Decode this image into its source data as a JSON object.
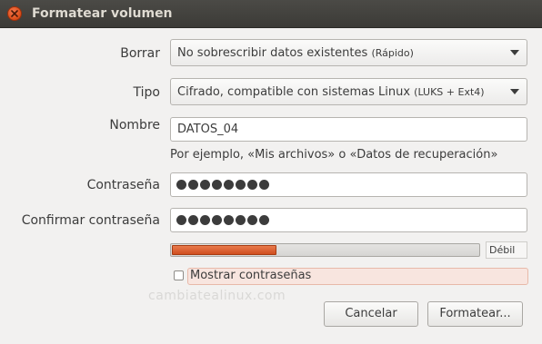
{
  "window": {
    "title": "Formatear volumen"
  },
  "form": {
    "erase": {
      "label": "Borrar",
      "value_main": "No sobrescribir datos existentes",
      "value_note": "(Rápido)"
    },
    "type": {
      "label": "Tipo",
      "value_main": "Cifrado, compatible con sistemas Linux",
      "value_note": "(LUKS + Ext4)"
    },
    "name": {
      "label": "Nombre",
      "value": "DATOS_04",
      "hint": "Por ejemplo, «Mis archivos» o «Datos de recuperación»"
    },
    "password": {
      "label": "Contraseña",
      "masked_length": 8
    },
    "confirm_password": {
      "label": "Confirmar contraseña",
      "masked_length": 8
    },
    "strength": {
      "level": 0.34,
      "label": "Débil",
      "color": "#e0592a"
    },
    "show_passwords": {
      "label": "Mostrar contraseñas",
      "checked": false
    }
  },
  "buttons": {
    "cancel": "Cancelar",
    "format": "Formatear..."
  },
  "watermark": "cambiatealinux.com",
  "colors": {
    "titlebar": "#3c3b37",
    "close_button": "#e0531f",
    "window_bg": "#f2f1f0"
  },
  "icons": {
    "close": "close-icon",
    "dropdown": "triangle-down-icon"
  }
}
